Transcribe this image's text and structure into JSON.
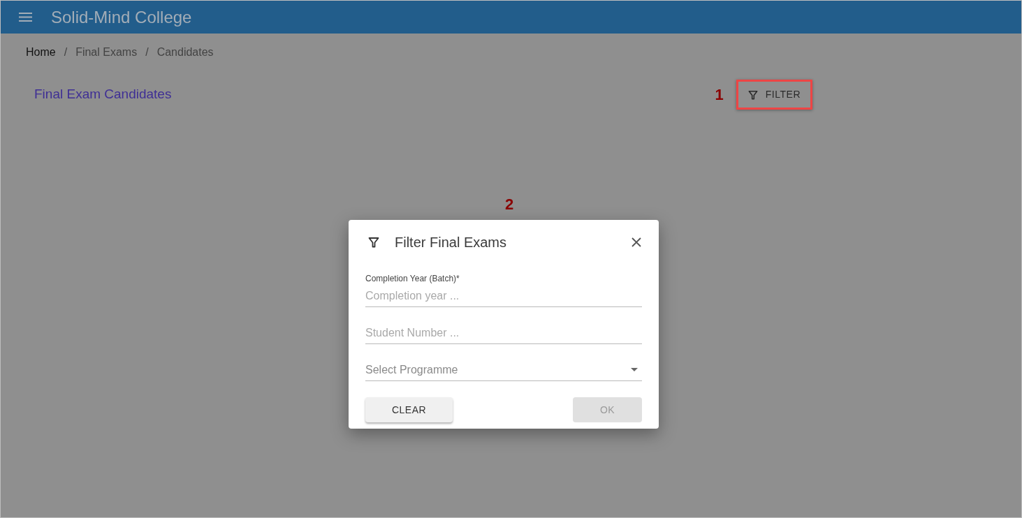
{
  "app_bar": {
    "title": "Solid-Mind College"
  },
  "breadcrumb": [
    {
      "label": "Home",
      "kind": "link"
    },
    {
      "separator": "/",
      "label": "Final Exams",
      "kind": "text"
    },
    {
      "separator": "/",
      "label": "Candidates",
      "kind": "text"
    }
  ],
  "page": {
    "title": "Final Exam Candidates",
    "filter_button": {
      "label": "FILTER",
      "highlighted": true,
      "annotation": "1"
    }
  },
  "dialog": {
    "annotation": "2",
    "title": "Filter Final Exams",
    "fields": [
      {
        "kind": "text",
        "label": "Completion Year (Batch)*",
        "placeholder": "Completion year ..."
      },
      {
        "kind": "text",
        "placeholder": "Student Number ..."
      },
      {
        "kind": "select",
        "placeholder": "Select Programme"
      }
    ],
    "buttons": [
      {
        "label": "CLEAR",
        "disabled": false
      },
      {
        "label": "OK",
        "disabled": true
      }
    ]
  }
}
